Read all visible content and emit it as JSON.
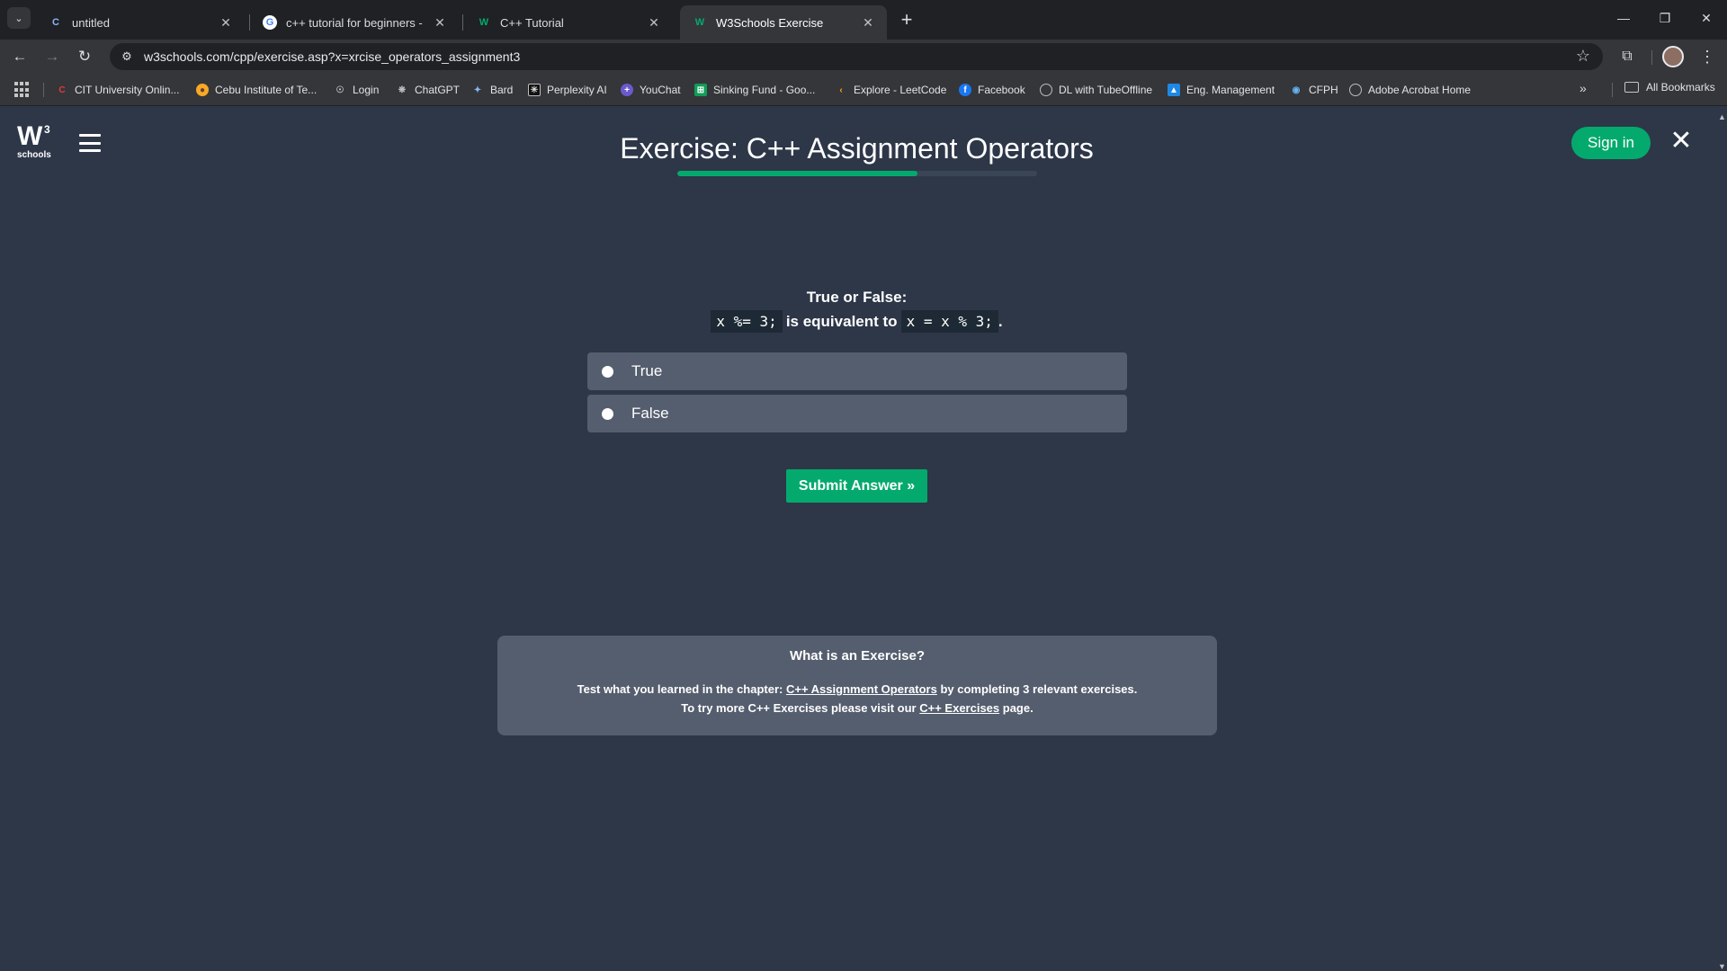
{
  "browser": {
    "tabs": [
      {
        "title": "untitled",
        "favicon": "c-logo-icon",
        "active": false
      },
      {
        "title": "c++ tutorial for beginners - Goo",
        "favicon": "google-icon",
        "active": false
      },
      {
        "title": "C++ Tutorial",
        "favicon": "w3schools-icon",
        "active": false
      },
      {
        "title": "W3Schools Exercise",
        "favicon": "w3schools-icon",
        "active": true
      }
    ],
    "url": "w3schools.com/cpp/exercise.asp?x=xrcise_operators_assignment3",
    "bookmarks": [
      {
        "label": "CIT University Onlin...",
        "icon": "cit-icon",
        "color": "#c62828"
      },
      {
        "label": "Cebu Institute of Te...",
        "icon": "cit-seal-icon",
        "color": "#f9a825"
      },
      {
        "label": "Login",
        "icon": "login-icon",
        "color": "#9e9e9e"
      },
      {
        "label": "ChatGPT",
        "icon": "chatgpt-icon",
        "color": "#9e9e9e"
      },
      {
        "label": "Bard",
        "icon": "bard-icon",
        "color": "#4285f4"
      },
      {
        "label": "Perplexity AI",
        "icon": "perplexity-icon",
        "color": "#202124"
      },
      {
        "label": "YouChat",
        "icon": "youchat-icon",
        "color": "#6a5acd"
      },
      {
        "label": "Sinking Fund - Goo...",
        "icon": "sheets-icon",
        "color": "#0f9d58"
      },
      {
        "label": "Explore - LeetCode",
        "icon": "leetcode-icon",
        "color": "#ffa116"
      },
      {
        "label": "Facebook",
        "icon": "facebook-icon",
        "color": "#1877f2"
      },
      {
        "label": "DL with TubeOffline",
        "icon": "globe-icon",
        "color": "#9e9e9e"
      },
      {
        "label": "Eng. Management",
        "icon": "photo-icon",
        "color": "#1e88e5"
      },
      {
        "label": "CFPH",
        "icon": "cfph-icon",
        "color": "#1e88e5"
      },
      {
        "label": "Adobe Acrobat Home",
        "icon": "globe-icon",
        "color": "#9e9e9e"
      }
    ],
    "all_bookmarks": "All Bookmarks"
  },
  "page": {
    "logo_text": "W",
    "logo_sup": "3",
    "logo_sub": "schools",
    "title": "Exercise: C++ Assignment Operators",
    "progress_fraction": 0.667,
    "sign_in": "Sign in",
    "question": {
      "heading": "True or False:",
      "code_a": "x %= 3;",
      "middle": "is equivalent to",
      "code_b": "x = x % 3;",
      "end": "."
    },
    "options": [
      "True",
      "False"
    ],
    "submit": "Submit Answer »",
    "info": {
      "title": "What is an Exercise?",
      "line1_pre": "Test what you learned in the chapter: ",
      "line1_link": "C++ Assignment Operators",
      "line1_post": " by completing 3 relevant exercises.",
      "line2_pre": "To try more C++ Exercises please visit our ",
      "line2_link": "C++ Exercises",
      "line2_post": " page."
    }
  },
  "colors": {
    "page_bg": "#2d3748",
    "accent_green": "#04aa6d",
    "option_bg": "#555e6e"
  }
}
